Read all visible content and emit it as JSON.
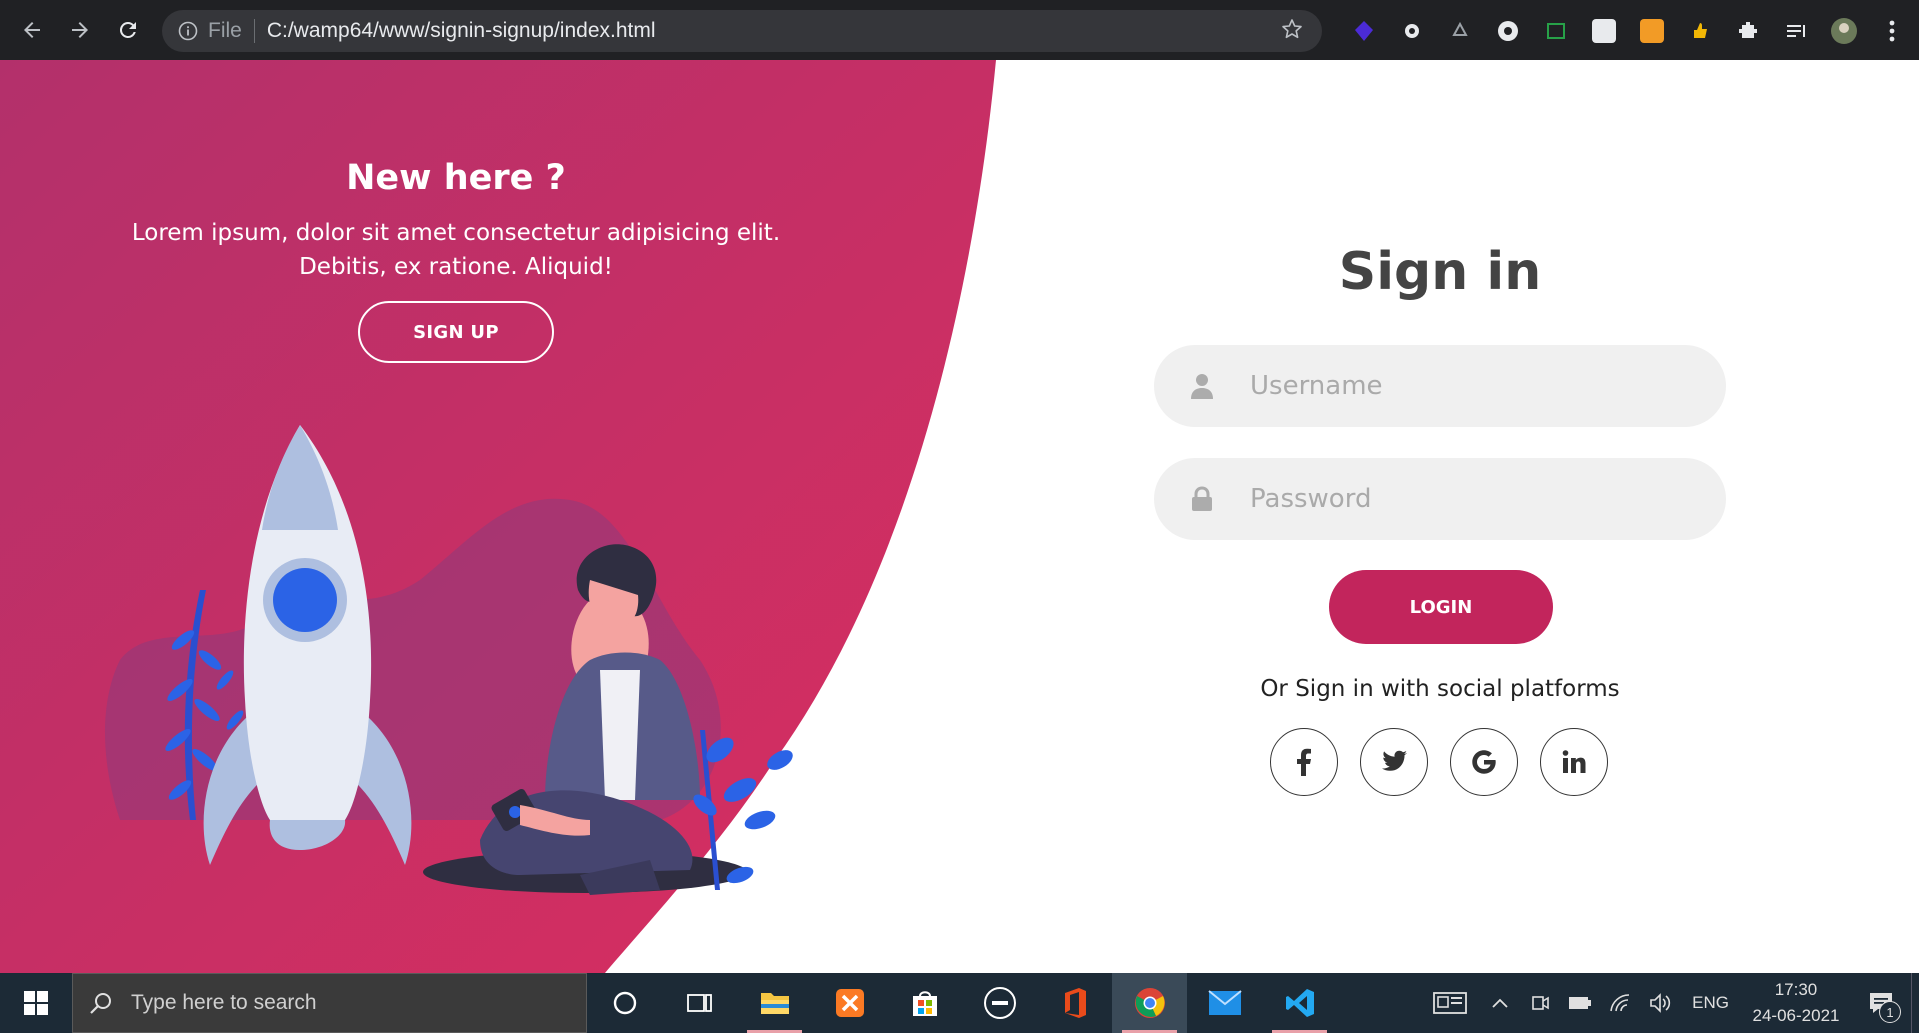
{
  "browser": {
    "file_label": "File",
    "url": "C:/wamp64/www/signin-signup/index.html",
    "icons": [
      "back-icon",
      "forward-icon",
      "reload-icon",
      "info-icon",
      "star-icon",
      "extensions-icon",
      "menu-icon"
    ]
  },
  "left_panel": {
    "title": "New here ?",
    "text": "Lorem ipsum, dolor sit amet consectetur adipisicing elit. Debitis, ex ratione. Aliquid!",
    "signup_label": "SIGN UP"
  },
  "signin": {
    "title": "Sign in",
    "username_placeholder": "Username",
    "password_placeholder": "Password",
    "login_label": "LOGIN",
    "social_text": "Or Sign in with social platforms",
    "social": [
      {
        "icon": "facebook-icon",
        "glyph": "f"
      },
      {
        "icon": "twitter-icon",
        "glyph": "t"
      },
      {
        "icon": "google-icon",
        "glyph": "G"
      },
      {
        "icon": "linkedin-icon",
        "glyph": "in"
      }
    ]
  },
  "taskbar": {
    "search_placeholder": "Type here to search",
    "lang": "ENG",
    "time": "17:30",
    "date": "24-06-2021",
    "notification_count": "1"
  },
  "colors": {
    "accent": "#c2255c",
    "panel_top": "#b3306b",
    "panel_bottom": "#d92e5f",
    "chrome": "#202124",
    "taskbar": "#1c2a36"
  }
}
